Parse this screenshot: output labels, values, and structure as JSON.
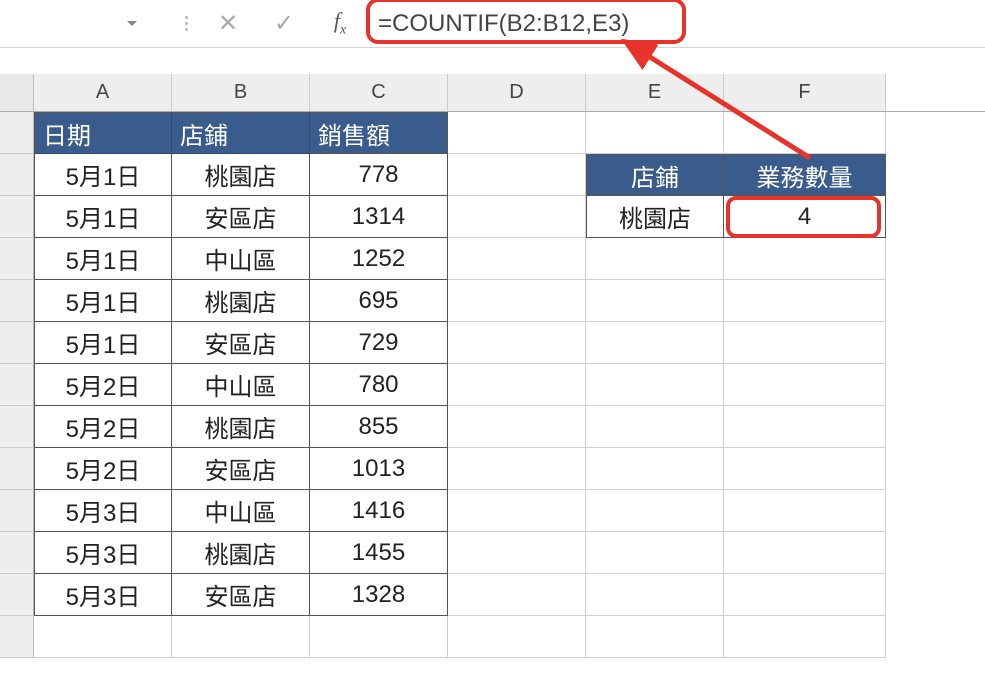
{
  "formula_bar": {
    "formula": "=COUNTIF(B2:B12,E3)"
  },
  "columns": [
    "A",
    "B",
    "C",
    "D",
    "E",
    "F"
  ],
  "table1": {
    "headers": [
      "日期",
      "店鋪",
      "銷售額"
    ],
    "rows": [
      {
        "date": "5月1日",
        "store": "桃園店",
        "sales": "778"
      },
      {
        "date": "5月1日",
        "store": "安區店",
        "sales": "1314"
      },
      {
        "date": "5月1日",
        "store": "中山區",
        "sales": "1252"
      },
      {
        "date": "5月1日",
        "store": "桃園店",
        "sales": "695"
      },
      {
        "date": "5月1日",
        "store": "安區店",
        "sales": "729"
      },
      {
        "date": "5月2日",
        "store": "中山區",
        "sales": "780"
      },
      {
        "date": "5月2日",
        "store": "桃園店",
        "sales": "855"
      },
      {
        "date": "5月2日",
        "store": "安區店",
        "sales": "1013"
      },
      {
        "date": "5月3日",
        "store": "中山區",
        "sales": "1416"
      },
      {
        "date": "5月3日",
        "store": "桃園店",
        "sales": "1455"
      },
      {
        "date": "5月3日",
        "store": "安區店",
        "sales": "1328"
      }
    ]
  },
  "table2": {
    "headers": [
      "店鋪",
      "業務數量"
    ],
    "row": {
      "store": "桃園店",
      "count": "4"
    }
  }
}
